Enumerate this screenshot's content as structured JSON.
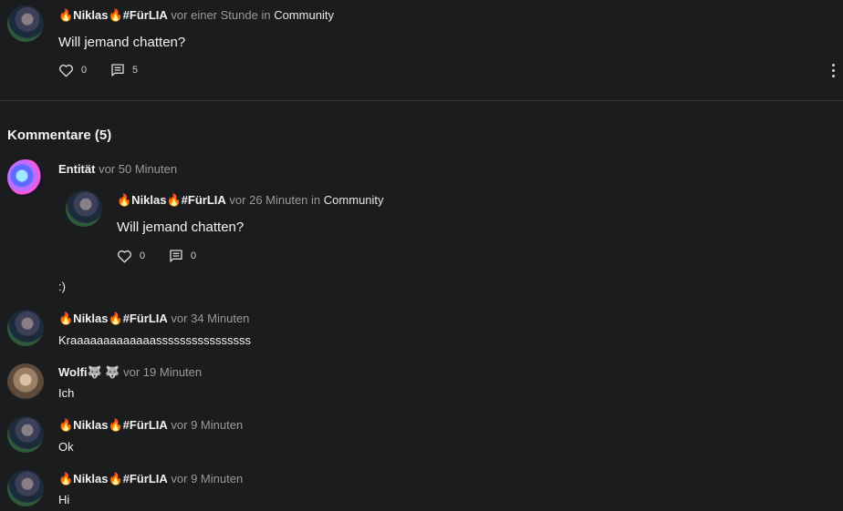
{
  "post": {
    "author": "🔥Niklas🔥#FürLIA",
    "time": "vor einer Stunde",
    "in_label": "in",
    "community": "Community",
    "text": "Will jemand chatten?",
    "likes": "0",
    "comments": "5"
  },
  "comments_heading": "Kommentare (5)",
  "comments": [
    {
      "author": "Entität",
      "time": "vor 50 Minuten",
      "shared_post": {
        "author": "🔥Niklas🔥#FürLIA",
        "time": "vor 26 Minuten",
        "in_label": "in",
        "community": "Community",
        "text": "Will jemand chatten?",
        "likes": "0",
        "comments": "0"
      },
      "text": ":)"
    },
    {
      "author": "🔥Niklas🔥#FürLIA",
      "time": "vor 34 Minuten",
      "text": "Kraaaaaaaaaaaaassssssssssssssss"
    },
    {
      "author": "Wolfi🐺 🐺",
      "time": "vor 19 Minuten",
      "text": "Ich"
    },
    {
      "author": "🔥Niklas🔥#FürLIA",
      "time": "vor 9 Minuten",
      "text": "Ok"
    },
    {
      "author": "🔥Niklas🔥#FürLIA",
      "time": "vor 9 Minuten",
      "text": "Hi"
    }
  ]
}
